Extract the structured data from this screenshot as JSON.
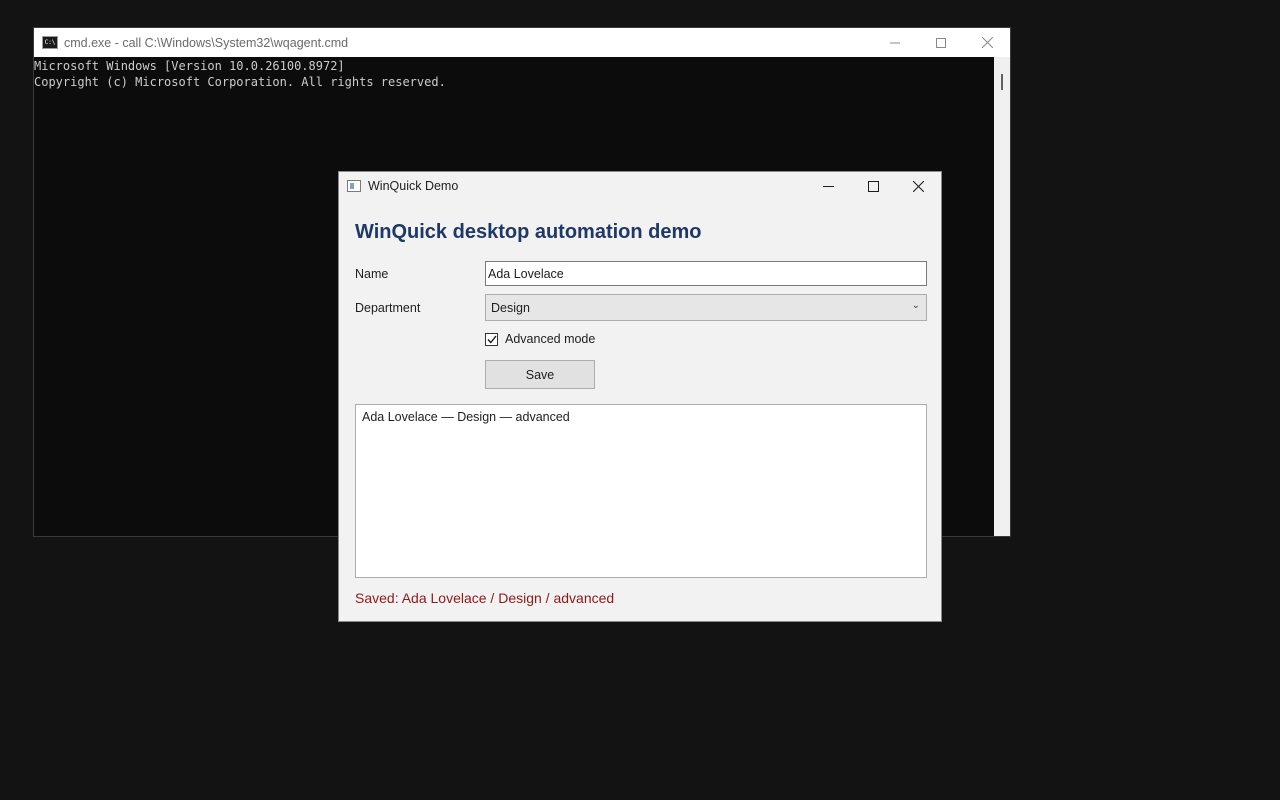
{
  "console": {
    "title": "cmd.exe - call  C:\\Windows\\System32\\wqagent.cmd",
    "icon_text": "C:\\",
    "lines": [
      "Microsoft Windows [Version 10.0.26100.8972]",
      "Copyright (c) Microsoft Corporation. All rights reserved."
    ]
  },
  "app": {
    "title": "WinQuick Demo",
    "heading": "WinQuick desktop automation demo",
    "name_label": "Name",
    "name_value": "Ada Lovelace",
    "department_label": "Department",
    "department_value": "Design",
    "advanced_label": "Advanced mode",
    "advanced_checked": true,
    "save_label": "Save",
    "output_text": "Ada Lovelace — Design — advanced",
    "status_text": "Saved: Ada Lovelace / Design / advanced"
  },
  "icons": {
    "minimize": "minimize-icon",
    "maximize": "maximize-icon",
    "close": "close-icon",
    "chevron": "chevron-down-icon",
    "check": "checkmark-icon"
  },
  "colors": {
    "desktop": "#131313",
    "heading": "#1f3864",
    "status": "#8b1a1a"
  }
}
